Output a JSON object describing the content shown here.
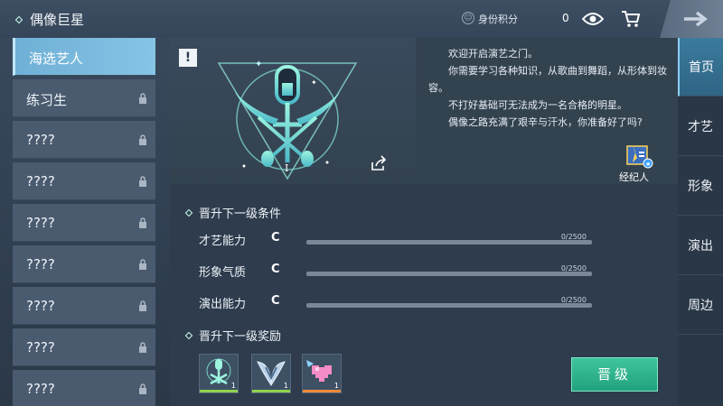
{
  "header": {
    "title": "偶像巨星",
    "score_label": "身份积分",
    "score_value": "0"
  },
  "careers": [
    {
      "label": "海选艺人",
      "locked": false,
      "active": true
    },
    {
      "label": "练习生",
      "locked": true,
      "active": false
    },
    {
      "label": "????",
      "locked": true,
      "active": false
    },
    {
      "label": "????",
      "locked": true,
      "active": false
    },
    {
      "label": "????",
      "locked": true,
      "active": false
    },
    {
      "label": "????",
      "locked": true,
      "active": false
    },
    {
      "label": "????",
      "locked": true,
      "active": false
    },
    {
      "label": "????",
      "locked": true,
      "active": false
    },
    {
      "label": "????",
      "locked": true,
      "active": false
    }
  ],
  "emblem": {
    "alert": "!",
    "level_numeral": "I"
  },
  "description": [
    "欢迎开启演艺之门。",
    "你需要学习各种知识，从歌曲到舞蹈，从形体到妆容。",
    "不打好基础可无法成为一名合格的明星。",
    "偶像之路充满了艰辛与汗水，你准备好了吗?"
  ],
  "agent_label": "经纪人",
  "conditions": {
    "heading": "晋升下一级条件",
    "stats": [
      {
        "name": "才艺能力",
        "grade": "C",
        "current": 0,
        "max": 2500,
        "count": "0/2500"
      },
      {
        "name": "形象气质",
        "grade": "C",
        "current": 0,
        "max": 2500,
        "count": "0/2500"
      },
      {
        "name": "演出能力",
        "grade": "C",
        "current": 0,
        "max": 2500,
        "count": "0/2500"
      }
    ]
  },
  "rewards": {
    "heading": "晋升下一级奖励",
    "items": [
      {
        "icon": "emblem-badge-icon",
        "qty": "1",
        "rarity_color": "#8fd14f"
      },
      {
        "icon": "wing-badge-icon",
        "qty": "1",
        "rarity_color": "#8fd14f"
      },
      {
        "icon": "pixel-heart-icon",
        "qty": "1",
        "rarity_color": "#f08a3a"
      }
    ]
  },
  "upgrade_label": "晋级",
  "right_tabs": [
    {
      "label": "首页",
      "active": true
    },
    {
      "label": "才艺",
      "active": false
    },
    {
      "label": "形象",
      "active": false
    },
    {
      "label": "演出",
      "active": false
    },
    {
      "label": "周边",
      "active": false
    }
  ],
  "colors": {
    "accent": "#6fb0d6",
    "upgrade": "#2fb58d",
    "emblem": "#7ee0d0"
  }
}
